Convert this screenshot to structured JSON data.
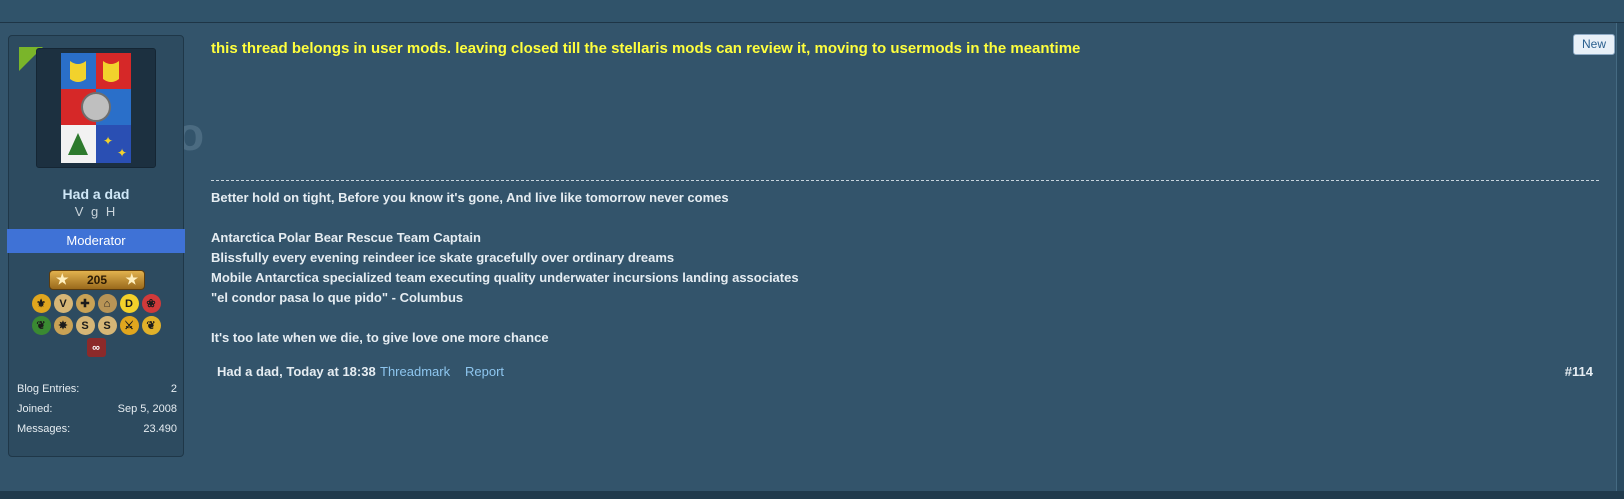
{
  "user": {
    "name": "Had a dad",
    "title": "V g H",
    "role": "Moderator",
    "level": "205",
    "awards": [
      "award-icon",
      "award-icon",
      "award-icon",
      "award-icon",
      "award-icon",
      "award-icon",
      "award-icon",
      "award-icon",
      "award-icon",
      "award-icon",
      "award-icon",
      "award-icon",
      "award-icon"
    ],
    "stats": [
      {
        "label": "Blog Entries:",
        "value": "2"
      },
      {
        "label": "Joined:",
        "value": "Sep 5, 2008"
      },
      {
        "label": "Messages:",
        "value": "23.490"
      }
    ]
  },
  "post": {
    "mod_note": "this thread belongs in user mods. leaving closed till the stellaris mods can review it, moving to usermods in the meantime",
    "new_label": "New",
    "signature": [
      "Better hold on tight, Before you know it's gone, And live like tomorrow never comes",
      "",
      "Antarctica Polar Bear Rescue Team Captain",
      "Blissfully every evening reindeer ice skate gracefully over ordinary dreams",
      "Mobile Antarctica specialized team executing quality underwater incursions landing associates",
      "\"el condor pasa lo que pido\" - Columbus",
      "",
      "It's too late when we die, to give love one more chance"
    ],
    "footer": {
      "author_date": "Had a dad, Today at 18:38",
      "threadmark": "Threadmark",
      "report": "Report",
      "post_number": "#114"
    }
  },
  "colors": {
    "mod_note": "#ffff3d",
    "role_banner": "#3f72d6",
    "link": "#8ec6ef",
    "background": "#33546b"
  }
}
